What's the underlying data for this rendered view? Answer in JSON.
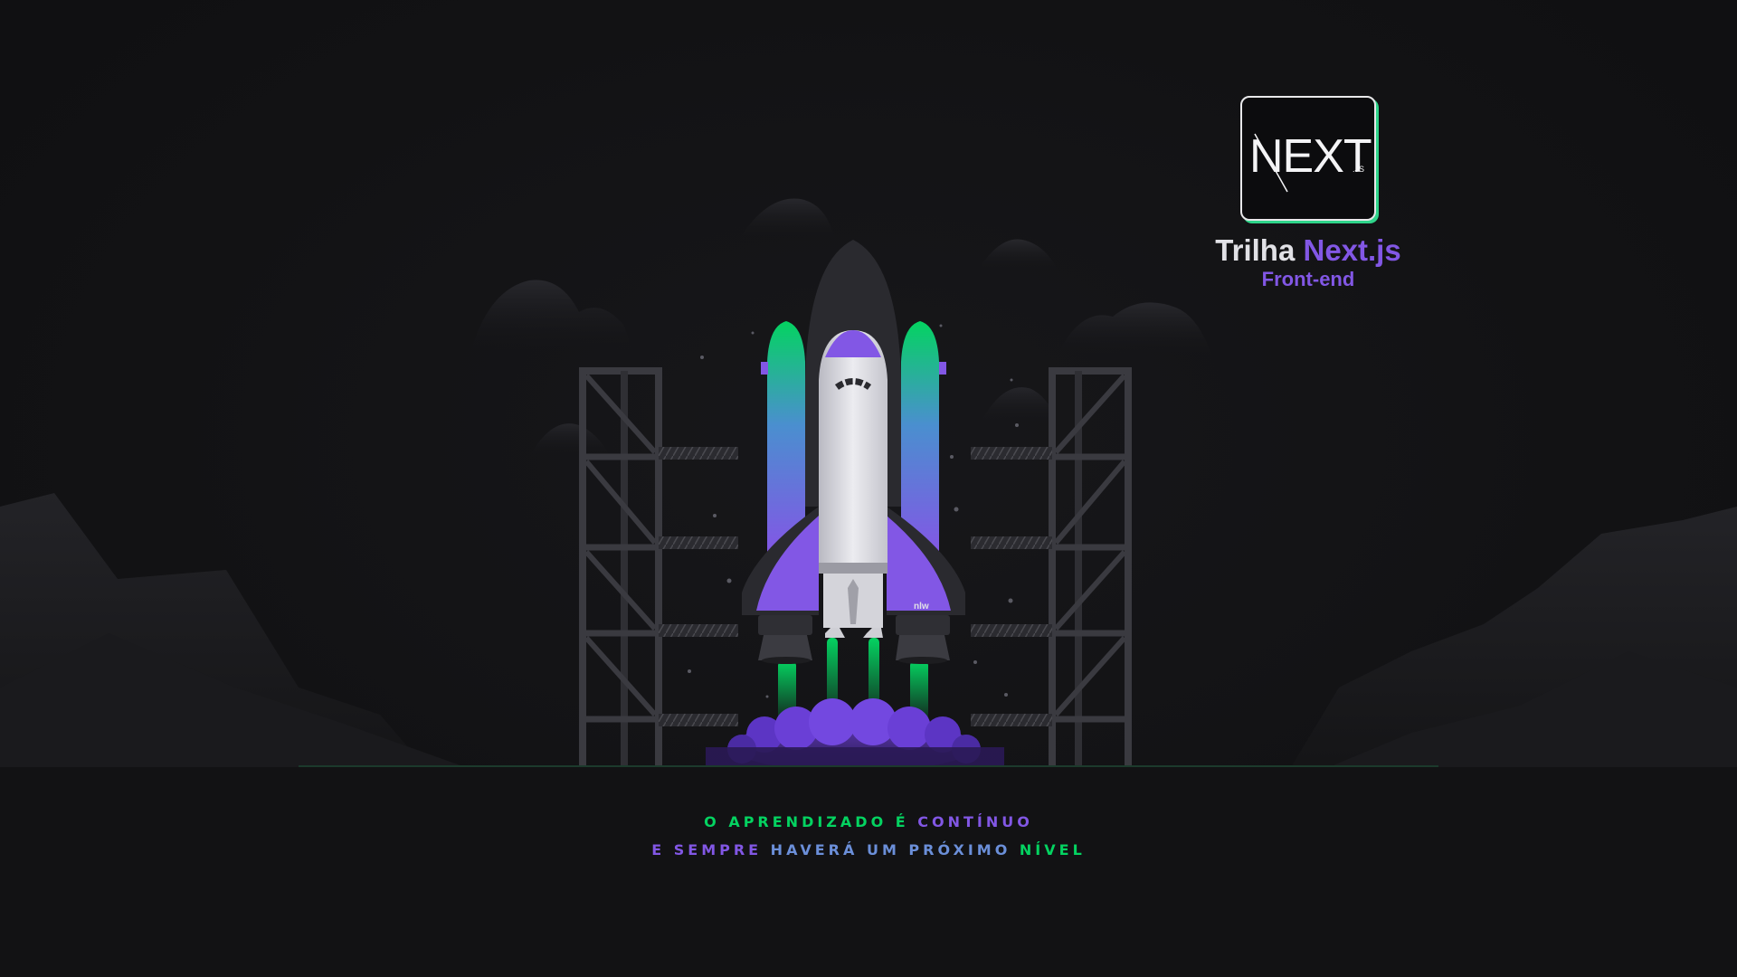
{
  "badge": {
    "logo_text": "NEXT",
    "logo_suffix": ".JS",
    "title_prefix": "Trilha",
    "title_accent": "Next.js",
    "subtitle": "Front-end"
  },
  "rocket": {
    "brand_mark": "nlw"
  },
  "tagline": {
    "line1_part1": "O aprendizado é",
    "line1_part2": "contínuo",
    "line2_part1": "e sempre",
    "line2_part2": "haverá um próximo",
    "line2_part3": "nível"
  },
  "colors": {
    "background": "#121214",
    "purple": "#8257e5",
    "green": "#04d361",
    "light": "#e1e1e6"
  }
}
